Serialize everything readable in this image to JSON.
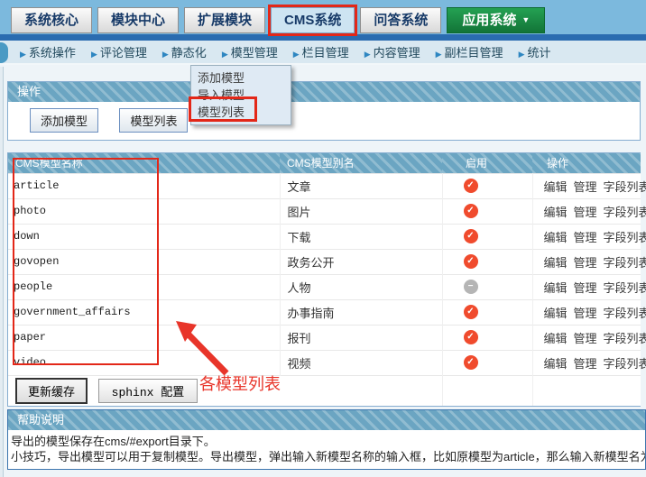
{
  "topnav": {
    "tabs": [
      {
        "label": "系统核心"
      },
      {
        "label": "模块中心"
      },
      {
        "label": "扩展模块"
      },
      {
        "label": "CMS系统"
      },
      {
        "label": "问答系统"
      },
      {
        "label": "应用系统"
      }
    ],
    "dropdown_caret": "▼"
  },
  "subnav": {
    "arrow_glyph": "▶",
    "items": [
      "系统操作",
      "评论管理",
      "静态化",
      "模型管理",
      "栏目管理",
      "内容管理",
      "副栏目管理",
      "统计"
    ]
  },
  "dropdown_menu": {
    "items": [
      "添加模型",
      "导入模型",
      "模型列表"
    ],
    "highlighted_item": "模型列表"
  },
  "op_section": {
    "title": "操作",
    "buttons": [
      "添加模型",
      "模型列表"
    ]
  },
  "model_table": {
    "headers": [
      "CMS模型名称",
      "CMS模型别名",
      "启用",
      "操作"
    ],
    "rows": [
      {
        "name": "article",
        "alias": "文章",
        "enabled": true,
        "actions": [
          "编辑",
          "管理",
          "字段列表"
        ]
      },
      {
        "name": "photo",
        "alias": "图片",
        "enabled": true,
        "actions": [
          "编辑",
          "管理",
          "字段列表"
        ]
      },
      {
        "name": "down",
        "alias": "下载",
        "enabled": true,
        "actions": [
          "编辑",
          "管理",
          "字段列表"
        ]
      },
      {
        "name": "govopen",
        "alias": "政务公开",
        "enabled": true,
        "actions": [
          "编辑",
          "管理",
          "字段列表"
        ]
      },
      {
        "name": "people",
        "alias": "人物",
        "enabled": false,
        "actions": [
          "编辑",
          "管理",
          "字段列表"
        ]
      },
      {
        "name": "government_affairs",
        "alias": "办事指南",
        "enabled": true,
        "actions": [
          "编辑",
          "管理",
          "字段列表"
        ]
      },
      {
        "name": "paper",
        "alias": "报刊",
        "enabled": true,
        "actions": [
          "编辑",
          "管理",
          "字段列表"
        ]
      },
      {
        "name": "video",
        "alias": "视频",
        "enabled": true,
        "actions": [
          "编辑",
          "管理",
          "字段列表"
        ]
      }
    ],
    "footer_buttons": [
      "更新缓存",
      "sphinx 配置"
    ]
  },
  "annotation": {
    "label": "各模型列表"
  },
  "help": {
    "title": "帮助说明",
    "lines": [
      "导出的模型保存在cms/#export目录下。",
      "小技巧，导出模型可以用于复制模型。导出模型，弹出输入新模型名称的输入框，比如原模型为article，那么输入新模型名为article"
    ]
  },
  "colors": {
    "accent_red": "#e32718",
    "topbar_bg": "#7cb9dd",
    "striped_header_base": "#6ba5c2",
    "enabled_icon": "#f04b2d",
    "disabled_icon": "#b5b5b5",
    "green_tab": "#1b9448"
  }
}
